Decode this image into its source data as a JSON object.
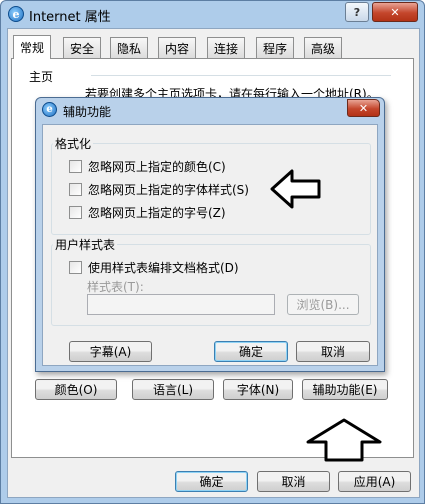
{
  "outer_window": {
    "title": "Internet 属性",
    "help_button": "?",
    "close_button": "✕",
    "tabs": [
      "常规",
      "安全",
      "隐私",
      "内容",
      "连接",
      "程序",
      "高级"
    ],
    "homepage_section": "主页",
    "homepage_hint": "若要创建多个主页选项卡，请在每行输入一个地址(R)。",
    "bottom_row_buttons": {
      "colors": "颜色(O)",
      "languages": "语言(L)",
      "fonts": "字体(N)",
      "accessibility": "辅助功能(E)"
    },
    "footer_buttons": {
      "ok": "确定",
      "cancel": "取消",
      "apply": "应用(A)"
    }
  },
  "accessibility_dialog": {
    "title": "辅助功能",
    "close_button": "✕",
    "formatting": {
      "label": "格式化",
      "options": [
        {
          "label": "忽略网页上指定的颜色(C)",
          "checked": false
        },
        {
          "label": "忽略网页上指定的字体样式(S)",
          "checked": false
        },
        {
          "label": "忽略网页上指定的字号(Z)",
          "checked": false
        }
      ]
    },
    "user_stylesheet": {
      "label": "用户样式表",
      "use_option": {
        "label": "使用样式表编排文档格式(D)",
        "checked": false
      },
      "stylesheet_label": "样式表(T):",
      "stylesheet_value": "",
      "browse_button": "浏览(B)..."
    },
    "buttons": {
      "captions": "字幕(A)",
      "ok": "确定",
      "cancel": "取消"
    }
  },
  "colors": {
    "window_frame": "#aeccea",
    "dialog_frame": "#b9d1ea",
    "close_red": "#c4462c",
    "face": "#f0f0f0"
  }
}
